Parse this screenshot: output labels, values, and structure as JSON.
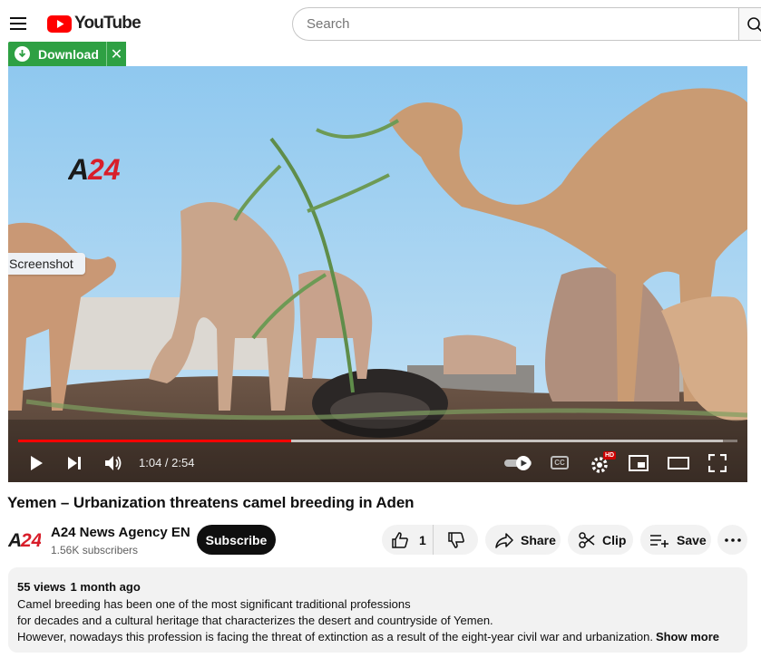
{
  "header": {
    "logo_text": "YouTube",
    "search_placeholder": "Search"
  },
  "extension": {
    "download_label": "Download",
    "close_label": "✕"
  },
  "player": {
    "overlay_tag": "Screenshot",
    "watermark": "A24",
    "time_current": "1:04",
    "time_separator": " / ",
    "time_total": "2:54",
    "progress_played_fraction": 0.38,
    "progress_buffered_fraction": 0.98,
    "hd_badge": "HD",
    "cc_label": "CC"
  },
  "video": {
    "title": "Yemen – Urbanization threatens camel breeding in Aden"
  },
  "channel": {
    "name": "A24 News Agency EN",
    "subscribers": "1.56K subscribers",
    "subscribe_label": "Subscribe"
  },
  "actions": {
    "like_count": "1",
    "share_label": "Share",
    "clip_label": "Clip",
    "save_label": "Save"
  },
  "description": {
    "views": "55 views",
    "date": "1 month ago",
    "lines": [
      "Camel breeding has been one of the most significant traditional professions",
      "for decades and a cultural heritage that characterizes the desert and countryside of Yemen.",
      "However, nowadays this profession is facing the threat of extinction as a result of the eight-year civil war and urbanization."
    ],
    "show_more": "Show more"
  },
  "colors": {
    "brand_red": "#ff0000",
    "download_green": "#2ea043"
  }
}
